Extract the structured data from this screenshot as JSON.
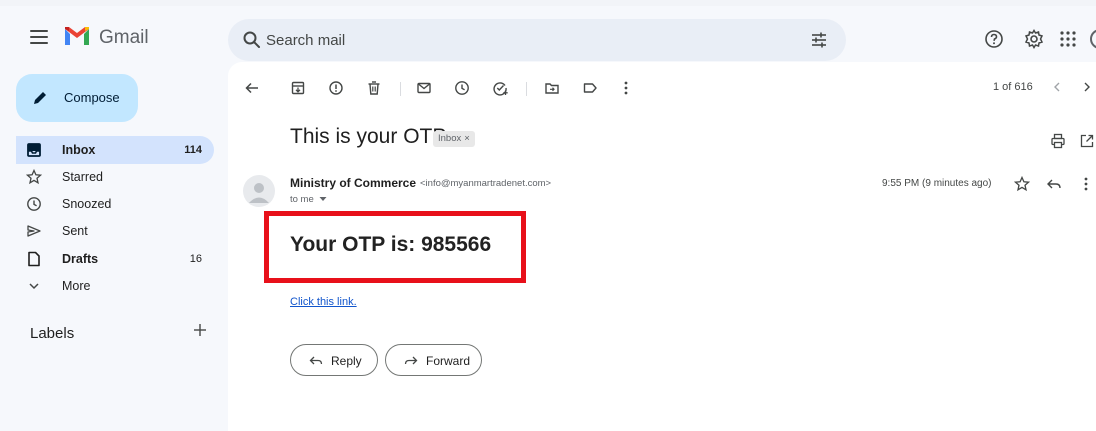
{
  "app": {
    "name": "Gmail"
  },
  "search": {
    "placeholder": "Search mail"
  },
  "compose": {
    "label": "Compose"
  },
  "sidebar": {
    "items": [
      {
        "label": "Inbox",
        "count": "114"
      },
      {
        "label": "Starred",
        "count": ""
      },
      {
        "label": "Snoozed",
        "count": ""
      },
      {
        "label": "Sent",
        "count": ""
      },
      {
        "label": "Drafts",
        "count": "16"
      },
      {
        "label": "More",
        "count": ""
      }
    ],
    "labels_title": "Labels"
  },
  "toolbar": {
    "pager": "1 of 616"
  },
  "email": {
    "subject": "This is your OTP",
    "chip": "Inbox",
    "chip_close": "×",
    "sender_name": "Ministry of Commerce",
    "sender_email": "<info@myanmartradenet.com>",
    "to": "to me",
    "time": "9:55 PM (9 minutes ago)",
    "otp_line": "Your OTP is: 985566",
    "link_text": "Click this link.",
    "reply_label": "Reply",
    "forward_label": "Forward"
  },
  "colors": {
    "compose_bg": "#c2e7ff",
    "active_item_bg": "#d3e3fd",
    "highlight_box": "#e8101a",
    "link": "#1155cc"
  }
}
